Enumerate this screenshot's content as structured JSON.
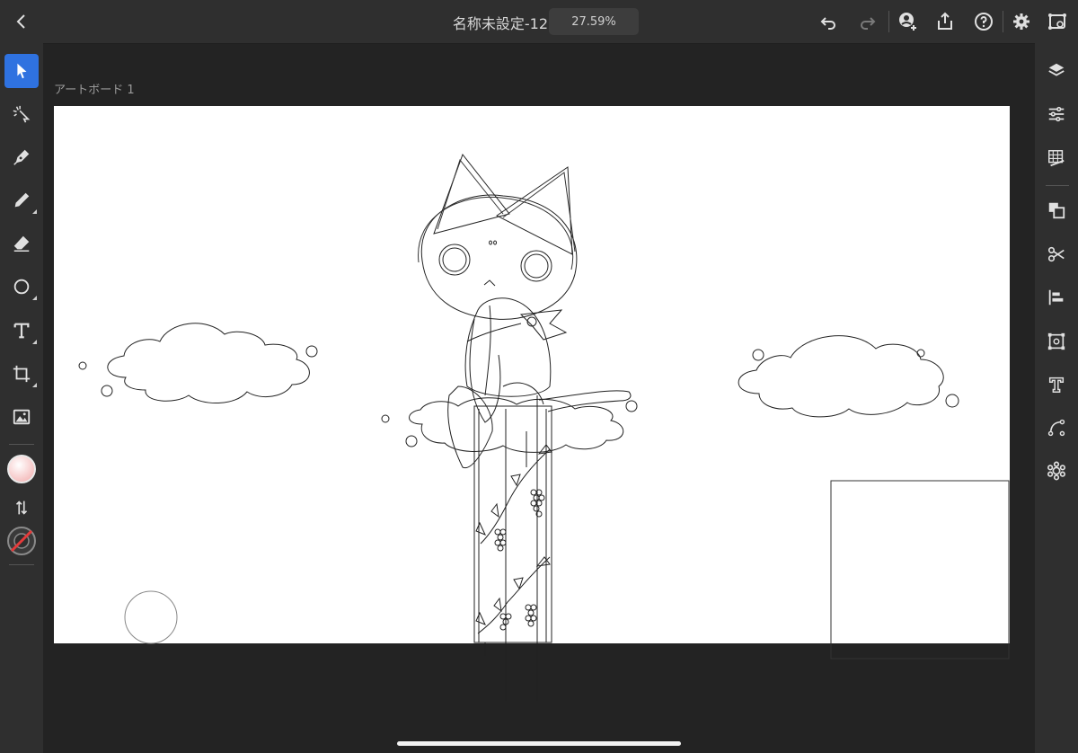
{
  "header": {
    "title": "名称未設定-12",
    "zoom": "27.59%"
  },
  "canvas": {
    "artboard_label": "アートボード 1",
    "artboard_color": "#ffffff",
    "workspace_color": "#232323"
  },
  "left_toolbar": {
    "active_tool": "selection",
    "fill_color": "#f4c4c4",
    "stroke_color": "none",
    "accent_color": "#2f72e0"
  },
  "icons": {
    "top": [
      "back-icon",
      "undo-icon",
      "redo-icon",
      "invite-icon",
      "share-icon",
      "help-icon",
      "settings-icon",
      "learn-icon"
    ],
    "left": [
      "selection-icon",
      "direct-selection-icon",
      "pen-icon",
      "pencil-icon",
      "eraser-icon",
      "ellipse-icon",
      "type-icon",
      "crop-icon",
      "image-icon",
      "swap-icon"
    ],
    "right": [
      "layers-icon",
      "properties-icon",
      "swatches-icon",
      "arrange-icon",
      "scissors-icon",
      "align-icon",
      "transform-icon",
      "fonts-icon",
      "path-icon",
      "effects-icon"
    ]
  }
}
